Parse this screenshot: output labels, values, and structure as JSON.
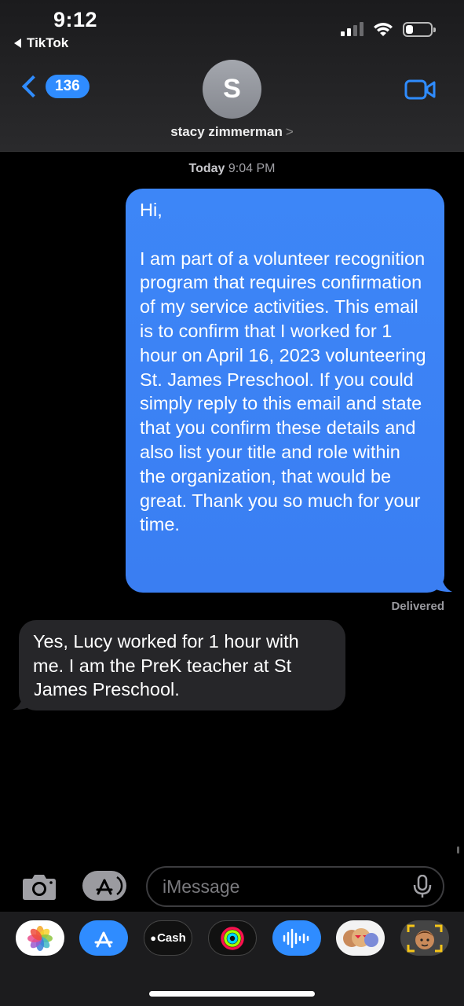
{
  "status_bar": {
    "time": "9:12",
    "back_app": "TikTok",
    "battery_level": 0.3
  },
  "header": {
    "unread_count": "136",
    "avatar_initial": "S",
    "contact_name": "stacy zimmerman",
    "contact_chevron": ">",
    "accent_color": "#2f8cff"
  },
  "thread": {
    "timestamp_day": "Today",
    "timestamp_time": "9:04 PM",
    "outgoing_message": "Hi,\n\nI am part of a volunteer recognition program that requires confirmation of my service activities. This email is to confirm that I worked for 1 hour on April 16, 2023 volunteering St. James Preschool. If you could simply reply to this email and state that you confirm these details and also list your title and role within the organization, that would be great. Thank you so much for your time.",
    "delivery_status": "Delivered",
    "incoming_message": "Yes, Lucy worked for 1 hour with me.  I am the PreK teacher at St James Preschool."
  },
  "composer": {
    "placeholder": "iMessage",
    "camera_icon": "camera-icon",
    "apps_icon": "app-store-icon",
    "mic_icon": "microphone-icon"
  },
  "app_drawer": {
    "cash_label": "Cash",
    "apps": [
      "photos-icon",
      "app-store-icon",
      "apple-cash-icon",
      "fitness-rings-icon",
      "audio-message-icon",
      "memoji-stickers-icon",
      "memoji-icon"
    ]
  }
}
